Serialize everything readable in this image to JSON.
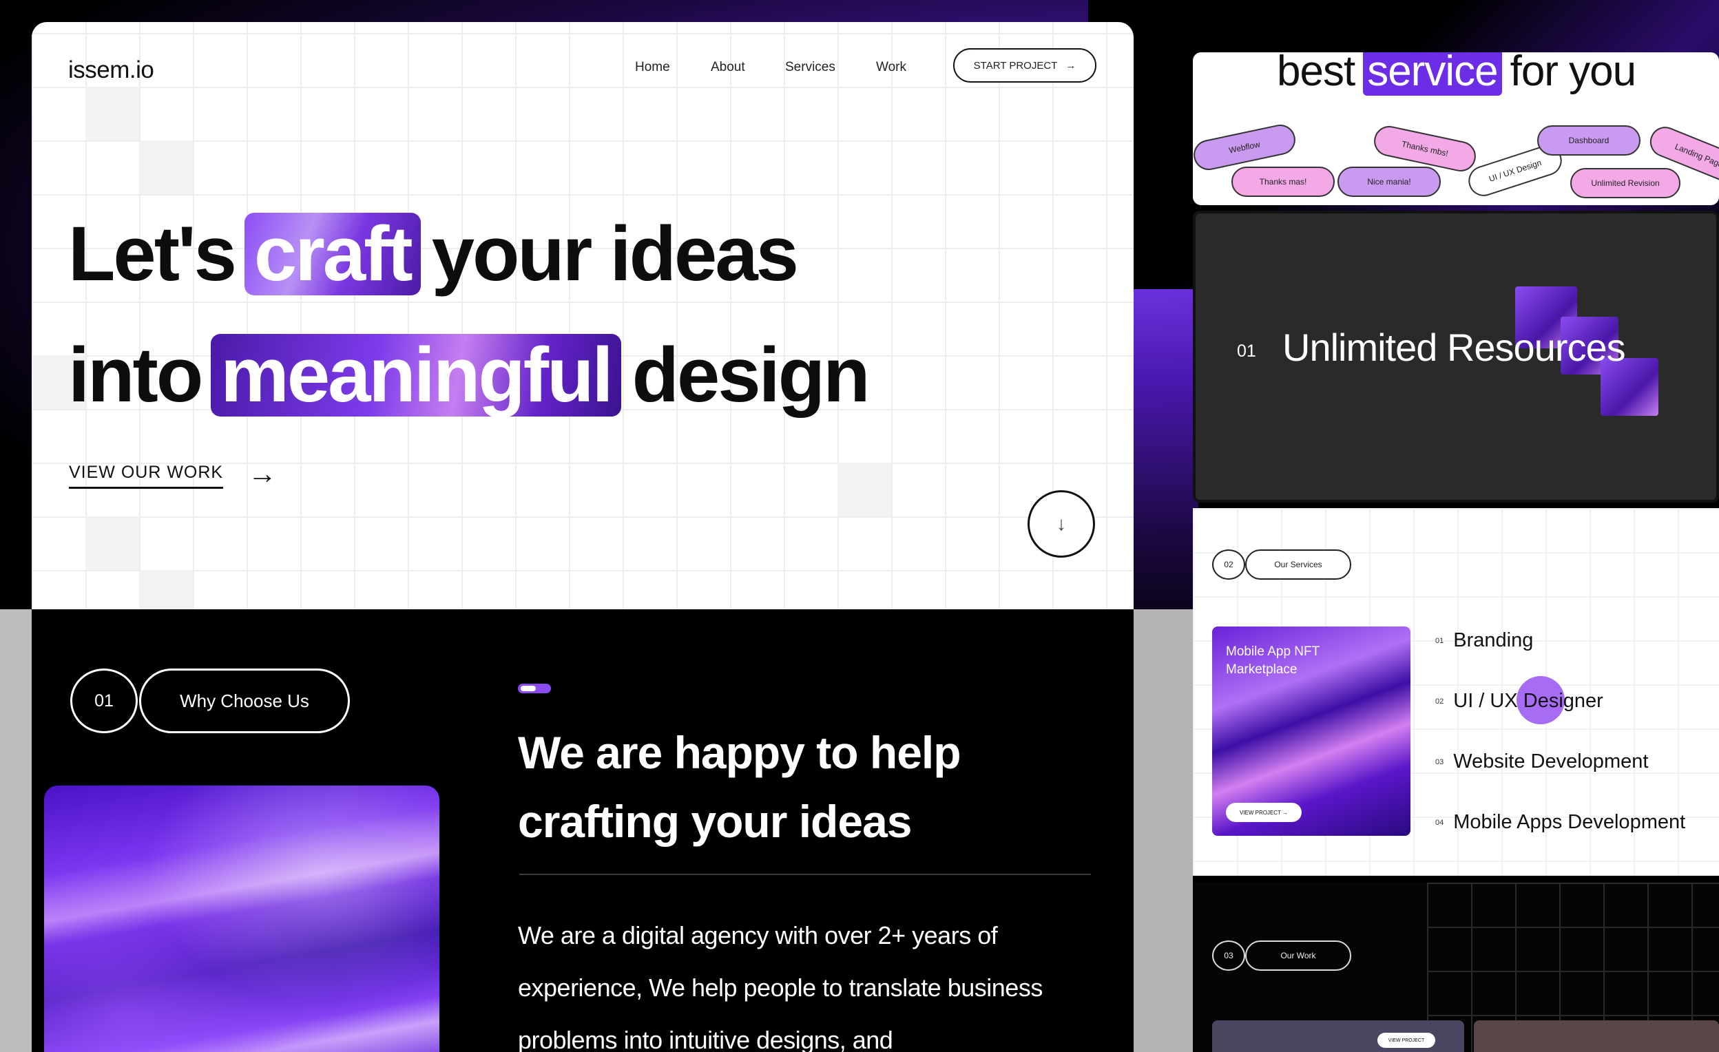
{
  "hero": {
    "logo": "issem.io",
    "nav": [
      "Home",
      "About",
      "Services",
      "Work"
    ],
    "start_button": "START PROJECT",
    "start_arrow": "→",
    "headline_line1": {
      "before": "Let's",
      "highlight": "craft",
      "after": "your ideas"
    },
    "headline_line2": {
      "before": "into",
      "highlight": "meaningful",
      "after": "design"
    },
    "view_work": "VIEW OUR WORK",
    "view_arrow": "→",
    "scroll_icon": "↓"
  },
  "about": {
    "number": "01",
    "pill": "Why Choose Us",
    "title": "We are happy to help crafting your ideas",
    "body": "We are a digital agency with over 2+ years of experience, We help people to translate business problems into intuitive designs, and"
  },
  "right": {
    "best_before": "best",
    "best_highlight": "service",
    "best_after": "for you",
    "chips": [
      "Webflow",
      "Thanks mas!",
      "Nice mania!",
      "Thanks mbs!",
      "UI / UX Design",
      "Dashboard",
      "Unlimited Revision",
      "Landing Page"
    ],
    "unlimited": {
      "number": "01",
      "title": "Unlimited Resources"
    },
    "services": {
      "number": "02",
      "pill": "Our Services",
      "card_title": "Mobile App NFT Marketplace",
      "card_button": "VIEW PROJECT →",
      "items": [
        {
          "n": "01",
          "label": "Branding"
        },
        {
          "n": "02",
          "label": "UI / UX Designer"
        },
        {
          "n": "03",
          "label": "Website Development"
        },
        {
          "n": "04",
          "label": "Mobile Apps Development"
        }
      ]
    },
    "work": {
      "number": "03",
      "pill": "Our Work",
      "card_button": "VIEW PROJECT"
    }
  },
  "colors": {
    "accent": "#7b3cf0",
    "dark": "#000000",
    "light": "#ffffff"
  }
}
